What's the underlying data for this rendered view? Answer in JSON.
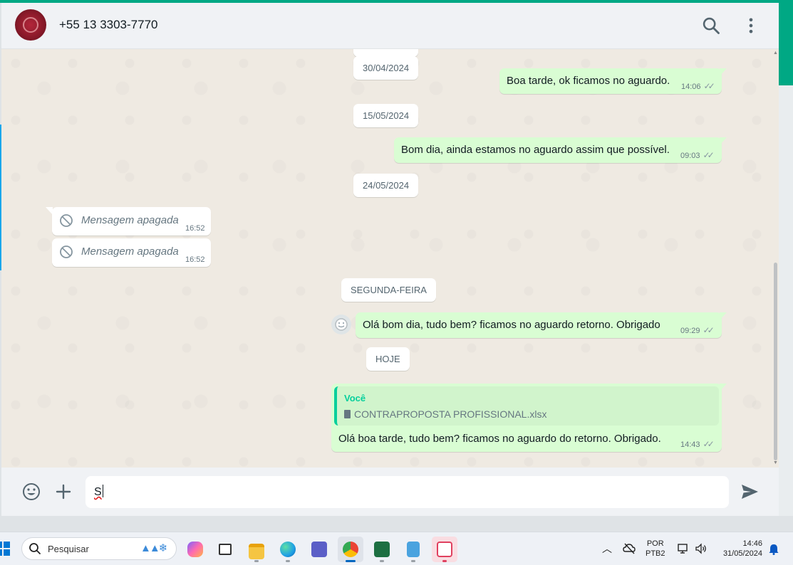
{
  "header": {
    "contact_name": "+55 13 3303-7770",
    "icons": [
      "search-icon",
      "menu-dots-icon"
    ]
  },
  "chat": {
    "partial_date": "30/04/2024",
    "items": [
      {
        "kind": "date",
        "text": "30/04/2024"
      },
      {
        "kind": "out",
        "text": "Boa tarde, ok ficamos no aguardo.",
        "time": "14:06",
        "status": "read"
      },
      {
        "kind": "date",
        "text": "15/05/2024"
      },
      {
        "kind": "out",
        "text": "Bom dia, ainda estamos no aguardo assim que possível.",
        "time": "09:03",
        "status": "read"
      },
      {
        "kind": "date",
        "text": "24/05/2024"
      },
      {
        "kind": "in_deleted",
        "text": "Mensagem apagada",
        "time": "16:52"
      },
      {
        "kind": "in_deleted",
        "text": "Mensagem apagada",
        "time": "16:52"
      },
      {
        "kind": "date",
        "text": "SEGUNDA-FEIRA"
      },
      {
        "kind": "out",
        "text": "Olá bom dia, tudo bem? ficamos no aguardo retorno. Obrigado",
        "time": "09:29",
        "status": "read"
      },
      {
        "kind": "date",
        "text": "HOJE"
      },
      {
        "kind": "out_reply",
        "quote_author": "Você",
        "quote_file": "CONTRAPROPOSTA PROFISSIONAL.xlsx",
        "text": "Olá boa tarde, tudo bem? ficamos no aguardo do retorno. Obrigado.",
        "time": "14:43",
        "status": "read"
      }
    ]
  },
  "composer": {
    "value": "S",
    "icons": [
      "emoji-icon",
      "plus-icon",
      "send-icon"
    ]
  },
  "taskbar": {
    "search_label": "Pesquisar",
    "apps": [
      "copilot",
      "task-view",
      "file-explorer",
      "edge",
      "teams",
      "chrome",
      "excel",
      "notepad",
      "snipping-tool"
    ],
    "active_app": "chrome",
    "language_line1": "POR",
    "language_line2": "PTB2",
    "time": "14:46",
    "date": "31/05/2024"
  },
  "colors": {
    "accent": "#00a884",
    "outgoing_bubble": "#d9fdd3",
    "incoming_bubble": "#ffffff",
    "chat_bg": "#efeae2",
    "read_ticks": "#8696a0",
    "quote_author": "#06cf9c"
  }
}
